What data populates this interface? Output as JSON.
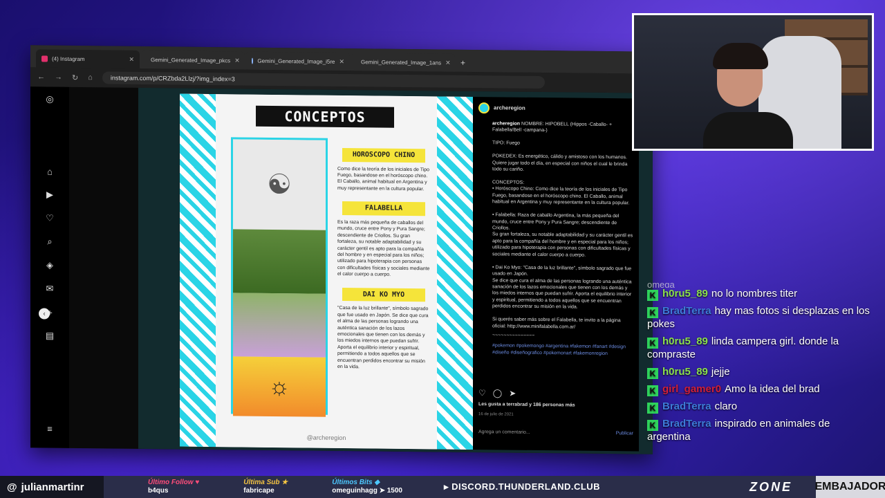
{
  "browser": {
    "tabs": [
      {
        "label": "(4) Instagram",
        "active": true,
        "icon": "instagram-icon"
      },
      {
        "label": "Gemini_Generated_Image_pkcs",
        "active": false,
        "icon": "image-icon"
      },
      {
        "label": "Gemini_Generated_Image_i5re",
        "active": false,
        "icon": "image-icon"
      },
      {
        "label": "Gemini_Generated_Image_1ans",
        "active": false,
        "icon": "image-icon"
      }
    ],
    "url": "instagram.com/p/CRZbda2Llzj/?img_index=3"
  },
  "post_image": {
    "title": "CONCEPTOS",
    "sections": [
      {
        "heading": "HOROSCOPO CHINO",
        "text": "Como dice la teoría de los iniciales de Tipo Fuego, basandose en el horóscopo chino. El Caballo, animal habitual en Argentina y muy representante en la cultura popular."
      },
      {
        "heading": "FALABELLA",
        "text": "Es la raza más pequeña de caballos del mundo, cruce entre Pony y Pura Sangre; descendiente de Criollos. Su gran fortaleza, su notable adaptabilidad y su carácter gentil es apto para la compañía del hombre y en especial para los niños; utilizado para hipoterapia con personas con dificultades físicas y sociales mediante el calor cuerpo a cuerpo."
      },
      {
        "heading": "DAI KO MYO",
        "text": "\"Casa de la luz brillante\", símbolo sagrado que fue usado en Japón. Se dice que cura el alma de las personas logrando una auténtica sanación de los lazos emocionales que tienen con los demás y los miedos internos que puedan sufrir. Aporta el equilibrio interior y espiritual, permitiendo a todos aquellos que se encuentran perdidos encontrar su misión en la vida."
      }
    ],
    "credit": "@archeregion"
  },
  "post": {
    "username": "archeregion",
    "caption_user": "archeregion",
    "caption": "NOMBRE: HIPOBELL (Hippos -Caballo- + Falabella/Bell -campana-)\n\nTIPO: Fuego\n\nPOKEDEX: Es energético, cálido y amistoso con los humanos. Quiere jugar todo el día, en especial con niños el cual le brinda todo su cariño.\n\nCONCEPTOS:\n• Horóscopo Chino: Como dice la teoría de los iniciales de Tipo Fuego, basandose en el horóscopo chino. El Caballo, animal habitual en Argentina y muy representante en la cultura popular.\n\n• Falabella: Raza de caballo Argentina, la más pequeña del mundo, cruce entre Pony y Pura Sangre; descendiente de Criollos.\nSu gran fortaleza, su notable adaptabilidad y su carácter gentil es apto para la compañía del hombre y en especial para los niños; utilizado para hipoterapia con personas con dificultades físicas y sociales mediante el calor cuerpo a cuerpo.\n\n• Dai Ko Myo: \"Casa de la luz brillante\", símbolo sagrado que fue usado en Japón.\nSe dice que cura el alma de las personas logrando una auténtica sanación de los lazos emocionales que tienen con los demás y los miedos internos que puedan sufrir. Aporta el equilibrio interior y espiritual, permitiendo a todos aquellos que se encuentran perdidos encontrar su misión en la vida.\n\nSi querés saber más sobre el Falabella, te invito a la página oficial: http://www.minifalabella.com.ar/",
    "separator": "~~~~~~~~~~~~~~~",
    "hashtags": "#pokemon #pokemongo #argentina #fakemon #fanart #design #diseño #diseñografico #pokemonart #fakemonregion",
    "likes": "Les gusta a terrabrad y 186 personas más",
    "date": "16 de julio de 2021",
    "comment_placeholder": "Agrega un comentario...",
    "publish": "Publicar"
  },
  "chat": {
    "clipped_top": "omega",
    "messages": [
      {
        "user": "h0ru5_89",
        "color": "#8be04e",
        "text": "no lo nombres titer"
      },
      {
        "user": "BradTerra",
        "color": "#3d7bd9",
        "text": "hay mas fotos si desplazas en los pokes"
      },
      {
        "user": "h0ru5_89",
        "color": "#8be04e",
        "text": "linda campera girl. donde la compraste"
      },
      {
        "user": "h0ru5_89",
        "color": "#8be04e",
        "text": "jejje"
      },
      {
        "user": "girl_gamer0",
        "color": "#d11f3a",
        "text": "Amo la idea del brad"
      },
      {
        "user": "BradTerra",
        "color": "#3d7bd9",
        "text": "claro"
      },
      {
        "user": "BradTerra",
        "color": "#3d7bd9",
        "text": "inspirado en animales de argentina"
      }
    ]
  },
  "overlay": {
    "handle": "julianmartinr",
    "last_follow_label": "Último Follow",
    "last_follow_value": "b4qus",
    "last_sub_label": "Última Sub",
    "last_sub_value": "fabricape",
    "last_bits_label": "Últimos Bits",
    "last_bits_value": "omeguinhagg",
    "last_bits_amount": "1500",
    "discord": "DISCORD.THUNDERLAND.CLUB",
    "brand": "ZONE",
    "ambassador": "EMBAJADOR",
    "colors": {
      "follow": "#ff4d7a",
      "sub": "#f5c542",
      "bits": "#4dc8ff"
    }
  }
}
